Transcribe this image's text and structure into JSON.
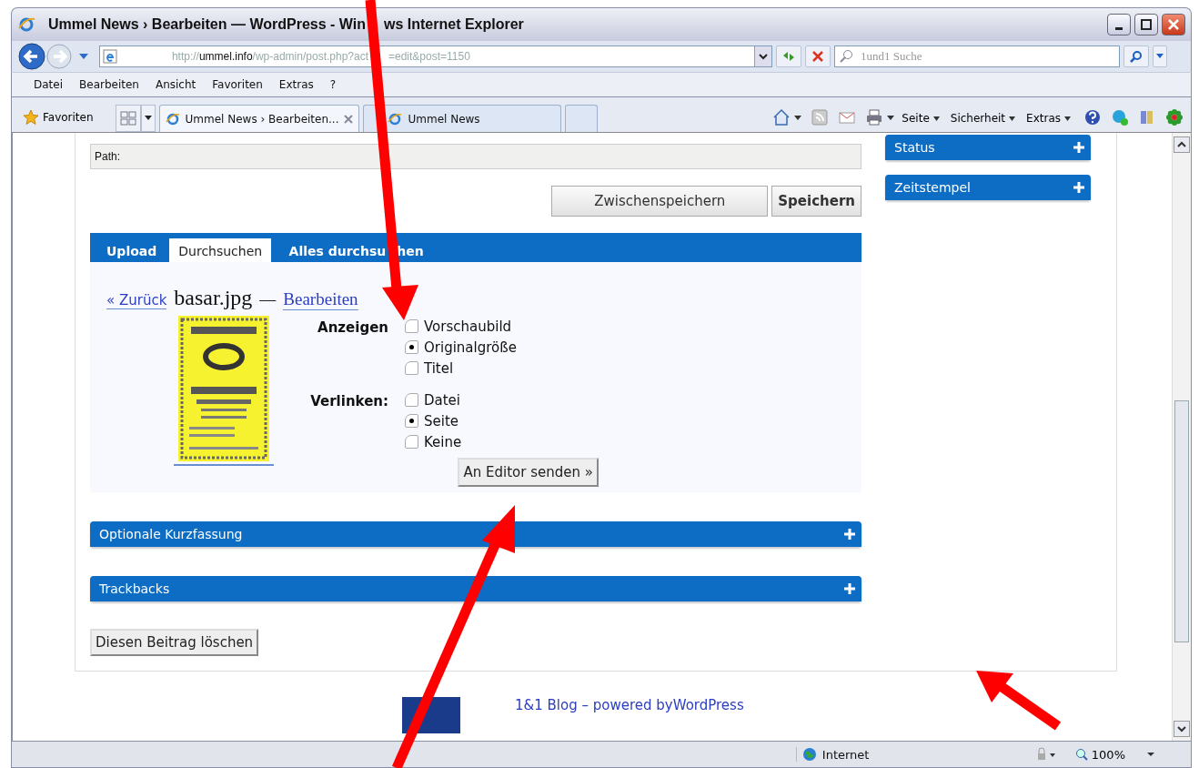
{
  "window": {
    "title_parts": [
      "Ummel News › Bearbeiten — WordPress - Win",
      "ws Internet Explorer"
    ]
  },
  "address": {
    "url_prefix": "http://",
    "url_host": "ummel.info",
    "url_path_parts": [
      "/wp-admin/post.php?act",
      "=edit&post=1150"
    ]
  },
  "search": {
    "placeholder": "1und1 Suche"
  },
  "menu": [
    "Datei",
    "Bearbeiten",
    "Ansicht",
    "Favoriten",
    "Extras",
    "?"
  ],
  "favorites": {
    "label": "Favoriten"
  },
  "tabs": [
    {
      "label": "Ummel News › Bearbeiten...",
      "selected": true
    },
    {
      "label": "Ummel News",
      "selected": false
    }
  ],
  "command_bar": [
    "Seite",
    "Sicherheit",
    "Extras"
  ],
  "editor": {
    "path_label": "Path:"
  },
  "save_buttons": [
    {
      "label": "Zwischenspeichern",
      "kind": "normal"
    },
    {
      "label": "Speichern",
      "kind": "primary"
    }
  ],
  "media_tabs": [
    {
      "label_parts": [
        "Upload"
      ],
      "selected": false
    },
    {
      "label_parts": [
        "Durchsuchen"
      ],
      "selected": true
    },
    {
      "label_parts": [
        "Alles durchsu",
        "hen"
      ],
      "selected": false
    }
  ],
  "media": {
    "back_link": "« Zurück",
    "filename": "basar.jpg",
    "dash": "—",
    "edit_link": "Bearbeiten",
    "groups": [
      {
        "label": "Anzeigen",
        "options": [
          {
            "label": "Vorschaubild",
            "selected": false
          },
          {
            "label": "Originalgröße",
            "selected": true
          },
          {
            "label": "Titel",
            "selected": false
          }
        ]
      },
      {
        "label": "Verlinken:",
        "options": [
          {
            "label": "Datei",
            "selected": false
          },
          {
            "label": "Seite",
            "selected": true
          },
          {
            "label": "Keine",
            "selected": false
          }
        ]
      }
    ],
    "send_button": "An Editor senden »"
  },
  "postboxes": [
    {
      "title": "Optionale Kurzfassung",
      "expanded": false
    },
    {
      "title": "Trackbacks",
      "expanded": false
    }
  ],
  "delete_button": "Diesen Beitrag löschen",
  "sidebar": [
    {
      "title": "Status"
    },
    {
      "title": "Zeitstempel"
    }
  ],
  "footer": {
    "link": "1&1 Blog – powered byWordPress"
  },
  "status_bar": {
    "zone": "Internet",
    "zoom": "100%"
  }
}
